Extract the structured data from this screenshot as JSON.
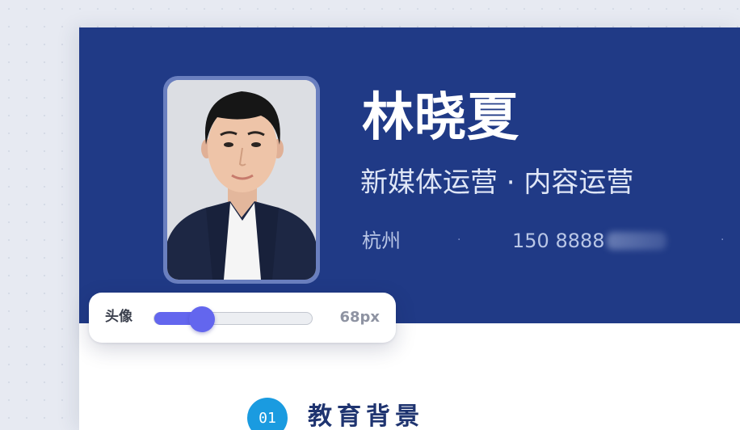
{
  "profile": {
    "name": "林晓夏",
    "title": "新媒体运营 · 内容运营",
    "city": "杭州",
    "separator": "·",
    "phone": "150 8888"
  },
  "avatar_slider": {
    "label": "头像",
    "value_text": "68px",
    "level_fraction": 0.3
  },
  "section": {
    "number": "01",
    "title": "教育背景"
  },
  "colors": {
    "banner": "#203a86",
    "slider_accent": "#6366ee",
    "section_badge": "#1a9be0",
    "section_title": "#1f3470"
  }
}
